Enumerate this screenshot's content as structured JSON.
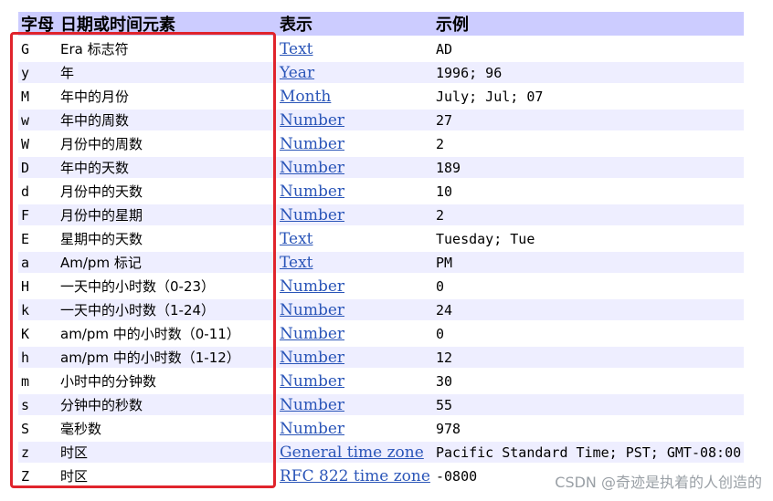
{
  "header": {
    "letter": "字母",
    "element": "日期或时间元素",
    "presentation": "表示",
    "example": "示例"
  },
  "rows": [
    {
      "letter": "G",
      "element": "Era 标志符",
      "presentation": "Text",
      "example": "AD"
    },
    {
      "letter": "y",
      "element": "年",
      "presentation": "Year",
      "example": "1996; 96"
    },
    {
      "letter": "M",
      "element": "年中的月份",
      "presentation": "Month",
      "example": "July; Jul; 07"
    },
    {
      "letter": "w",
      "element": "年中的周数",
      "presentation": "Number",
      "example": "27"
    },
    {
      "letter": "W",
      "element": "月份中的周数",
      "presentation": "Number",
      "example": "2"
    },
    {
      "letter": "D",
      "element": "年中的天数",
      "presentation": "Number",
      "example": "189"
    },
    {
      "letter": "d",
      "element": "月份中的天数",
      "presentation": "Number",
      "example": "10"
    },
    {
      "letter": "F",
      "element": "月份中的星期",
      "presentation": "Number",
      "example": "2"
    },
    {
      "letter": "E",
      "element": "星期中的天数",
      "presentation": "Text",
      "example": "Tuesday; Tue"
    },
    {
      "letter": "a",
      "element": "Am/pm 标记",
      "presentation": "Text",
      "example": "PM"
    },
    {
      "letter": "H",
      "element": "一天中的小时数（0-23）",
      "presentation": "Number",
      "example": "0"
    },
    {
      "letter": "k",
      "element": "一天中的小时数（1-24）",
      "presentation": "Number",
      "example": "24"
    },
    {
      "letter": "K",
      "element": "am/pm 中的小时数（0-11）",
      "presentation": "Number",
      "example": "0"
    },
    {
      "letter": "h",
      "element": "am/pm 中的小时数（1-12）",
      "presentation": "Number",
      "example": "12"
    },
    {
      "letter": "m",
      "element": "小时中的分钟数",
      "presentation": "Number",
      "example": "30"
    },
    {
      "letter": "s",
      "element": "分钟中的秒数",
      "presentation": "Number",
      "example": "55"
    },
    {
      "letter": "S",
      "element": "毫秒数",
      "presentation": "Number",
      "example": "978"
    },
    {
      "letter": "z",
      "element": "时区",
      "presentation": "General time zone",
      "example": "Pacific Standard Time; PST; GMT-08:00"
    },
    {
      "letter": "Z",
      "element": "时区",
      "presentation": "RFC 822 time zone",
      "example": "-0800"
    }
  ],
  "watermark": "CSDN @奇迹是执着的人创造的",
  "colors": {
    "header_bg": "#ccccff",
    "alt_row_bg": "#eeeeff",
    "link": "#2a55b8",
    "highlight_border": "#e0242c"
  }
}
